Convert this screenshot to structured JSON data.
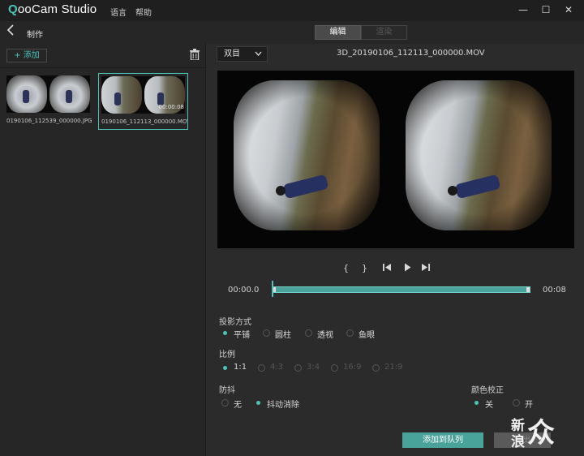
{
  "app": {
    "logo_prefix": "Q",
    "logo_text": "ooCam Studio",
    "menu": [
      "语言",
      "帮助"
    ],
    "window_controls": [
      "—",
      "☐",
      "✕"
    ]
  },
  "subbar": {
    "back_icon": "chevron-left-icon",
    "title": "制作",
    "tabs": [
      {
        "label": "编辑",
        "active": true
      },
      {
        "label": "渲染",
        "active": false
      }
    ]
  },
  "library": {
    "add_label": "+ 添加",
    "items": [
      {
        "name": "0190106_112539_000000.JPG",
        "duration": "",
        "selected": false
      },
      {
        "name": "0190106_112113_000000.MOV",
        "duration": "00:00:08",
        "selected": true
      }
    ]
  },
  "viewer": {
    "mode": "双目",
    "filename": "3D_20190106_112113_000000.MOV"
  },
  "timeline": {
    "start": "00:00.0",
    "end": "00:08",
    "buttons": [
      "{",
      "}",
      "|◀",
      "▶",
      "▶|"
    ]
  },
  "settings": {
    "projection": {
      "title": "投影方式",
      "options": [
        "平铺",
        "圆柱",
        "透视",
        "鱼眼"
      ],
      "selected": 0
    },
    "ratio": {
      "title": "比例",
      "options": [
        "1:1",
        "4:3",
        "3:4",
        "16:9",
        "21:9"
      ],
      "selected": 0
    },
    "stabilization": {
      "title": "防抖",
      "options": [
        "无",
        "抖动消除"
      ],
      "selected": 1
    },
    "color_correction": {
      "title": "颜色校正",
      "options": [
        "关",
        "开"
      ],
      "selected": 0
    }
  },
  "actions": {
    "add_to_queue": "添加到队列",
    "export": "导出"
  },
  "watermark": {
    "line1": "新",
    "line2": "浪",
    "line3": "众"
  },
  "colors": {
    "accent": "#4cc3b8",
    "background": "#2b2b2b",
    "titlebar": "#1f1f1f"
  }
}
